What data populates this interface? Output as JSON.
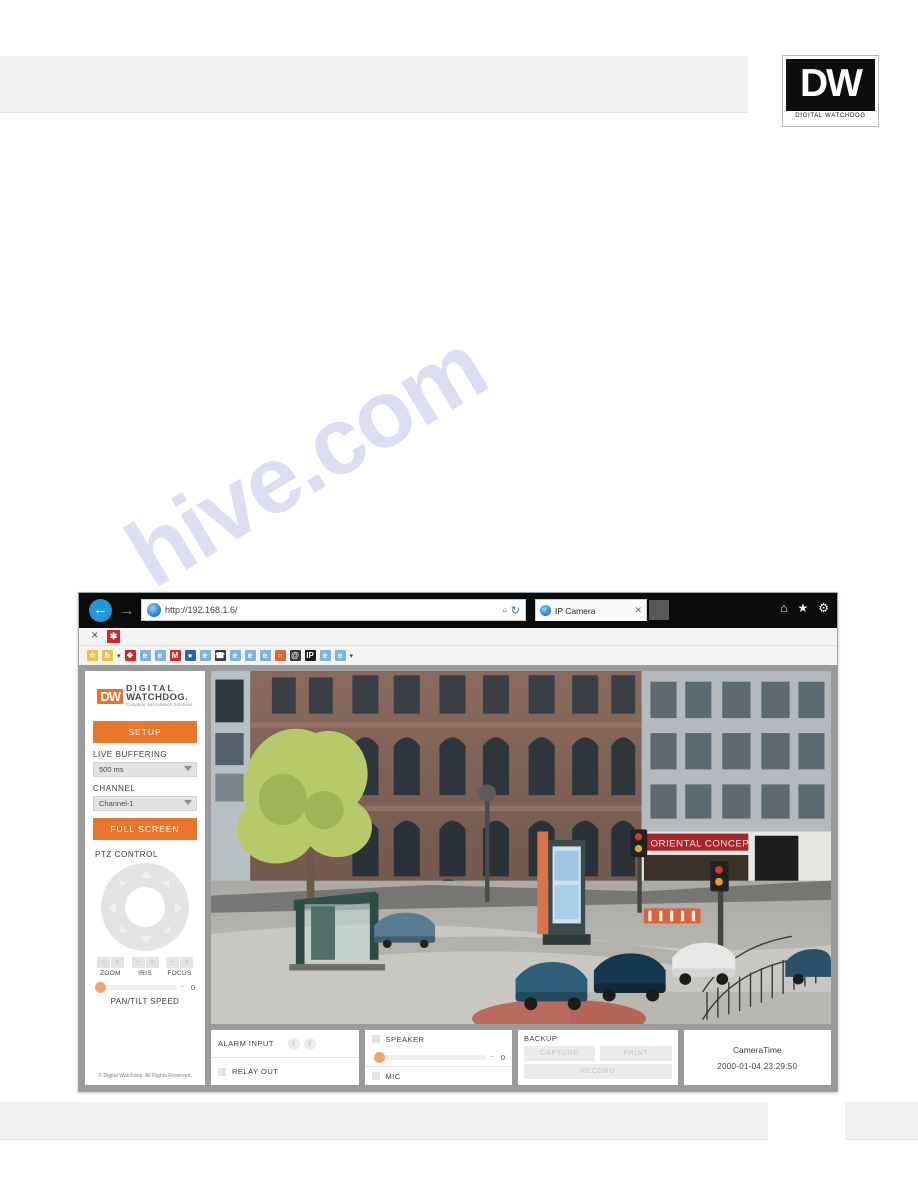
{
  "document": {
    "logo": {
      "mark": "DW",
      "caption": "DIGITAL WATCHDOG"
    },
    "watermark": "hive.com"
  },
  "browser": {
    "back_label": "←",
    "forward_label": "→",
    "address": {
      "value": "http://192.168.1.6/",
      "value_prefix": "http://",
      "value_host": "192.168.1.6/",
      "search_glyph": "⌕",
      "refresh_glyph": "↻"
    },
    "tab": {
      "title": "IP Camera",
      "close_label": "✕"
    },
    "toolbar_icons": [
      {
        "name": "home-icon",
        "glyph": "⌂"
      },
      {
        "name": "favorites-star-icon",
        "glyph": "★"
      },
      {
        "name": "settings-gear-icon",
        "glyph": "⚙"
      }
    ],
    "command_strip": {
      "close_label": "✕",
      "addon_label": "✱"
    },
    "favorites": [
      {
        "name": "favorite-add-icon",
        "glyph": "☆",
        "color": "#e8c44a"
      },
      {
        "name": "favorite-bing-icon",
        "glyph": "b",
        "color": "#e8c44a"
      },
      {
        "name": "favorite-caret-icon",
        "glyph": "▾",
        "color": "transparent"
      },
      {
        "name": "favorite-diamond-icon",
        "glyph": "❖",
        "color": "#d8232a"
      },
      {
        "name": "favorite-page-icon-1",
        "glyph": "e",
        "color": "#7fb3dd"
      },
      {
        "name": "favorite-page-icon-2",
        "glyph": "e",
        "color": "#7fb3dd"
      },
      {
        "name": "favorite-gmail-icon",
        "glyph": "M",
        "color": "#d8232a"
      },
      {
        "name": "favorite-globe-icon",
        "glyph": "●",
        "color": "#2a5fb8"
      },
      {
        "name": "favorite-page-icon-3",
        "glyph": "e",
        "color": "#7fb3dd"
      },
      {
        "name": "favorite-phone-icon",
        "glyph": "☎",
        "color": "#3a3a3a"
      },
      {
        "name": "favorite-page-icon-4",
        "glyph": "e",
        "color": "#7fb3dd"
      },
      {
        "name": "favorite-page-icon-5",
        "glyph": "e",
        "color": "#7fb3dd"
      },
      {
        "name": "favorite-page-icon-6",
        "glyph": "e",
        "color": "#7fb3dd"
      },
      {
        "name": "favorite-circle-icon",
        "glyph": "○",
        "color": "#e0603a"
      },
      {
        "name": "favorite-at-icon",
        "glyph": "@",
        "color": "#3a3a3a"
      },
      {
        "name": "favorite-ip-icon",
        "glyph": "IP",
        "color": "#1a1a1a"
      },
      {
        "name": "favorite-page-icon-7",
        "glyph": "e",
        "color": "#7fb3dd"
      },
      {
        "name": "favorite-page-icon-8",
        "glyph": "e",
        "color": "#7fb3dd"
      },
      {
        "name": "favorite-overflow-caret",
        "glyph": "▾",
        "color": "transparent"
      }
    ]
  },
  "sidebar": {
    "logo": {
      "mark": "DW",
      "line1": "DIGITAL",
      "line2": "WATCHDOG.",
      "tagline": "Complete Surveillance Solutions"
    },
    "setup_button": "SETUP",
    "live_buffering": {
      "label": "LIVE BUFFERING",
      "value": "500 ms"
    },
    "channel": {
      "label": "CHANNEL",
      "value": "Channel-1"
    },
    "fullscreen_button": "FULL SCREEN",
    "ptz": {
      "title": "PTZ CONTROL",
      "lens": [
        {
          "label": "ZOOM",
          "minus": "−",
          "plus": "+"
        },
        {
          "label": "IRIS",
          "minus": "−",
          "plus": "+"
        },
        {
          "label": "FOCUS",
          "minus": "−",
          "plus": "+"
        }
      ],
      "speed": {
        "label": "PAN/TILT SPEED",
        "value": "0",
        "minus": "−"
      }
    },
    "copyright": "© Digital Watchdog. All Rights Reserved."
  },
  "panels": {
    "alarm": {
      "input_label": "ALARM INPUT",
      "inputs": [
        "1",
        "2"
      ],
      "relay_label": "RELAY OUT"
    },
    "audio": {
      "speaker_label": "SPEAKER",
      "speaker_value": "0",
      "speaker_minus": "−",
      "mic_label": "MIC"
    },
    "backup": {
      "title": "BACKUP",
      "capture": "CAPTURE",
      "print": "PRINT",
      "record": "RECORD"
    },
    "time": {
      "title": "CameraTime",
      "value": "2000-01-04 23:29:50"
    }
  },
  "video": {
    "shop_sign": "ORIENTAL CONCEPTS"
  },
  "colors": {
    "accent_orange": "#e8762c",
    "logo_orange": "#e8712c",
    "browser_chrome": "#0b0b0b",
    "page_bg": "#9a9a9a"
  }
}
